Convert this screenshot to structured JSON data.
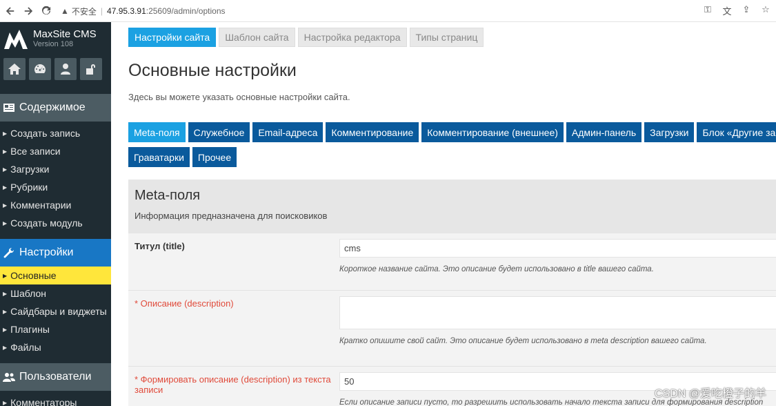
{
  "browser": {
    "insecure_label": "不安全",
    "url_host": "47.95.3.91",
    "url_rest": ":25609/admin/options"
  },
  "brand": {
    "name": "MaxSite CMS",
    "version": "Version 108"
  },
  "sidebar": {
    "sections": [
      {
        "title": "Содержимое",
        "items": [
          "Создать запись",
          "Все записи",
          "Загрузки",
          "Рубрики",
          "Комментарии",
          "Создать модуль"
        ]
      },
      {
        "title": "Настройки",
        "items": [
          "Основные",
          "Шаблон",
          "Сайдбары и виджеты",
          "Плагины",
          "Файлы"
        ]
      },
      {
        "title": "Пользователи",
        "items": [
          "Комментаторы"
        ]
      }
    ]
  },
  "top_tabs": [
    "Настройки сайта",
    "Шаблон сайта",
    "Настройка редактора",
    "Типы страниц"
  ],
  "page": {
    "title": "Основные настройки",
    "subtitle": "Здесь вы можете указать основные настройки сайта."
  },
  "section_tabs": {
    "row1": [
      "Meta-поля",
      "Служебное",
      "Email-адреса",
      "Комментирование",
      "Комментирование (внешнее)",
      "Админ-панель",
      "Загрузки",
      "Блок «Другие за"
    ],
    "row2": [
      "Граватарки",
      "Прочее"
    ]
  },
  "panel": {
    "title": "Meta-поля",
    "description": "Информация предназначена для поисковиков",
    "fields": [
      {
        "label": "Титул (title)",
        "value": "cms",
        "hint": "Короткое название сайта. Это описание будет использовано в title вашего сайта."
      },
      {
        "label": "* Описание (description)",
        "value": "",
        "hint": "Кратко опишите свой сайт. Это описание будет использовано в meta description вашего сайта."
      },
      {
        "label": "* Формировать описание (description) из текста записи",
        "value": "50",
        "hint": "Если описание записи пусто, то разрешить использовать начало текста записи для формирования description"
      }
    ]
  },
  "watermark": "CSDN @爱吃橙子的羊",
  "colors": {
    "sidebar_bg": "#1f2c33",
    "section_head": "#4c5c63",
    "active_section": "#1877c5",
    "current_item": "#ffe63b",
    "tab_active": "#1ba1e2",
    "tab_dark": "#0a5a9c",
    "required": "#e04a3a"
  }
}
